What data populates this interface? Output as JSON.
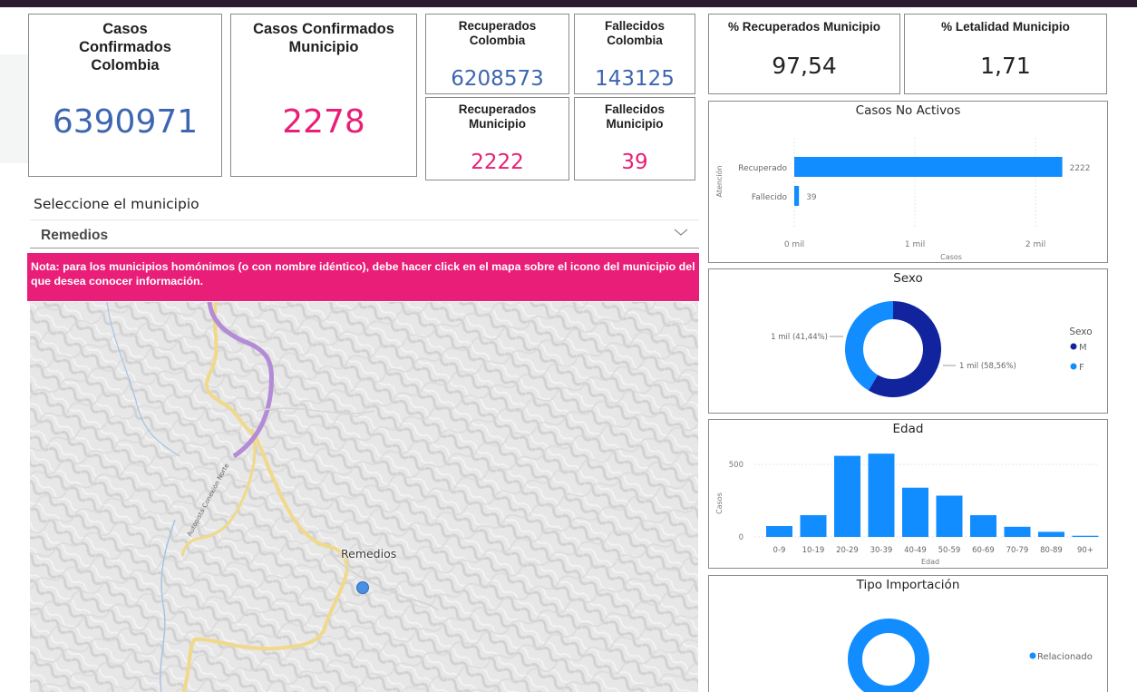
{
  "kpis": {
    "confirmados_colombia": {
      "label": "Casos Confirmados Colombia",
      "value": "6390971"
    },
    "confirmados_municipio": {
      "label": "Casos Confirmados Municipio",
      "value": "2278"
    },
    "recuperados_colombia": {
      "label": "Recuperados Colombia",
      "value": "6208573"
    },
    "fallecidos_colombia": {
      "label": "Fallecidos Colombia",
      "value": "143125"
    },
    "recuperados_municipio": {
      "label": "Recuperados Municipio",
      "value": "2222"
    },
    "fallecidos_municipio": {
      "label": "Fallecidos Municipio",
      "value": "39"
    },
    "pct_recuperados": {
      "label": "% Recuperados Municipio",
      "value": "97,54"
    },
    "pct_letalidad": {
      "label": "% Letalidad Municipio",
      "value": "1,71"
    }
  },
  "colors": {
    "blue_value": "#3d66b0",
    "pink_value": "#e81f76",
    "bar_blue": "#118dff",
    "dark_navy": "#12239e"
  },
  "slicer": {
    "label": "Seleccione el municipio",
    "value": "Remedios",
    "icon": "chevron-down-icon"
  },
  "note": {
    "text": "Nota: para los municipios homónimos (o con nombre idéntico), debe hacer click en el mapa sobre el icono del municipio del que desea conocer información."
  },
  "map": {
    "place_label": "Remedios",
    "road_label": "Autopista Conexión Norte"
  },
  "chart_data": [
    {
      "type": "bar",
      "orientation": "horizontal",
      "title": "Casos No Activos",
      "xlabel": "Casos",
      "ylabel": "Atención",
      "categories": [
        "Recuperado",
        "Fallecido"
      ],
      "values": [
        2222,
        39
      ],
      "data_labels": [
        "2222",
        "39"
      ],
      "xticks": [
        "0 mil",
        "1 mil",
        "2 mil"
      ],
      "xlim": [
        0,
        2300
      ]
    },
    {
      "type": "pie",
      "title": "Sexo",
      "legend_title": "Sexo",
      "categories": [
        "M",
        "F"
      ],
      "values": [
        58.56,
        41.44
      ],
      "data_labels": [
        "1 mil (58,56%)",
        "1 mil (41,44%)"
      ],
      "colors": [
        "#12239e",
        "#118dff"
      ],
      "legend": "right"
    },
    {
      "type": "bar",
      "title": "Edad",
      "xlabel": "Edad",
      "ylabel": "Casos",
      "categories": [
        "0-9",
        "10-19",
        "20-29",
        "30-39",
        "40-49",
        "50-59",
        "60-69",
        "70-79",
        "80-89",
        "90+"
      ],
      "values": [
        75,
        150,
        560,
        575,
        340,
        285,
        150,
        70,
        35,
        8
      ],
      "yticks": [
        "0",
        "500"
      ],
      "ylim": [
        0,
        620
      ]
    },
    {
      "type": "pie",
      "title": "Tipo Importación",
      "categories": [
        "Relacionado"
      ],
      "values": [
        100
      ],
      "colors": [
        "#118dff"
      ],
      "legend": "right"
    }
  ]
}
